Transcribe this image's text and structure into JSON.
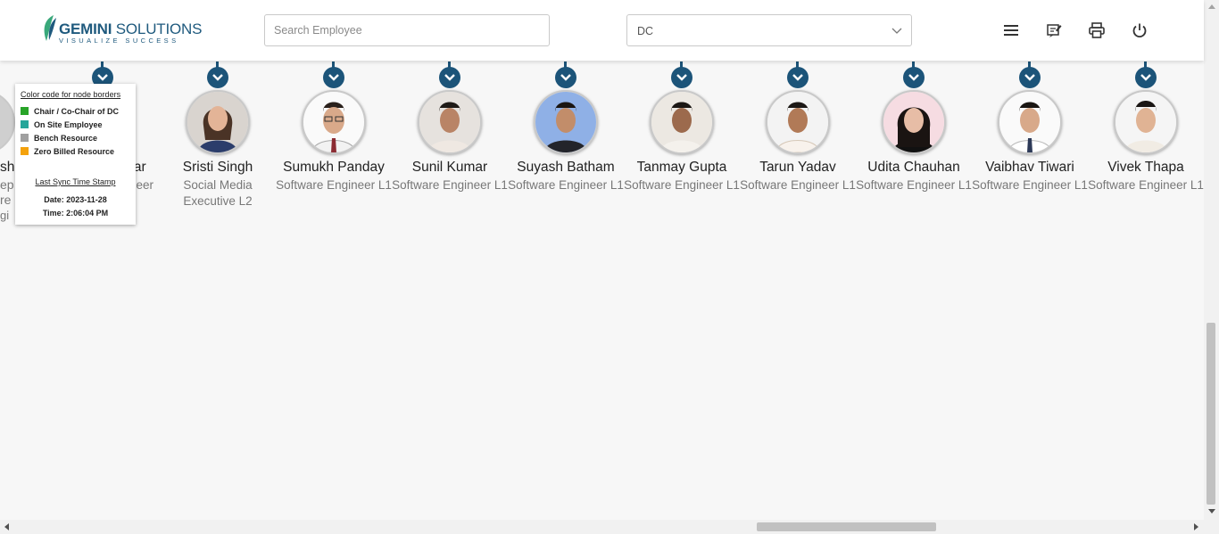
{
  "header": {
    "logo_name_bold": "GEMINI",
    "logo_name_rest": " SOLUTIONS",
    "logo_tagline": "VISUALIZE SUCCESS",
    "search_placeholder": "Search Employee",
    "department_value": "DC",
    "icons": [
      "menu-icon",
      "notes-icon",
      "print-icon",
      "power-icon"
    ]
  },
  "legend": {
    "title": "Color code for node borders",
    "items": [
      {
        "label": "Chair / Co-Chair of DC",
        "color": "#28a428"
      },
      {
        "label": "On Site Employee",
        "color": "#26a69a"
      },
      {
        "label": "Bench Resource",
        "color": "#a0a0a0"
      },
      {
        "label": "Zero Billed Resource",
        "color": "#f4a20c"
      }
    ],
    "sync_title": "Last Sync Time Stamp",
    "sync_date": "Date: 2023-11-28",
    "sync_time": "Time: 2:06:04 PM"
  },
  "partial_nodes": {
    "left_fragments": [
      "sh",
      "ep",
      "re",
      "gi"
    ],
    "souvik_name": "Souvik Laskar",
    "souvik_role": "eer"
  },
  "employees": [
    {
      "name": "Sristi Singh",
      "role": "Social Media Executive L2"
    },
    {
      "name": "Sumukh Panday",
      "role": "Software Engineer L1"
    },
    {
      "name": "Sunil Kumar",
      "role": "Software Engineer L1"
    },
    {
      "name": "Suyash Batham",
      "role": "Software Engineer L1"
    },
    {
      "name": "Tanmay Gupta",
      "role": "Software Engineer L1"
    },
    {
      "name": "Tarun Yadav",
      "role": "Software Engineer L1"
    },
    {
      "name": "Udita Chauhan",
      "role": "Software Engineer L1"
    },
    {
      "name": "Vaibhav Tiwari",
      "role": "Software Engineer L1"
    },
    {
      "name": "Vivek Thapa",
      "role": "Software Engineer L1"
    }
  ],
  "colors": {
    "brand": "#1f5a7e",
    "toggle": "#1c5479",
    "node_border": "#c9c9c9"
  }
}
